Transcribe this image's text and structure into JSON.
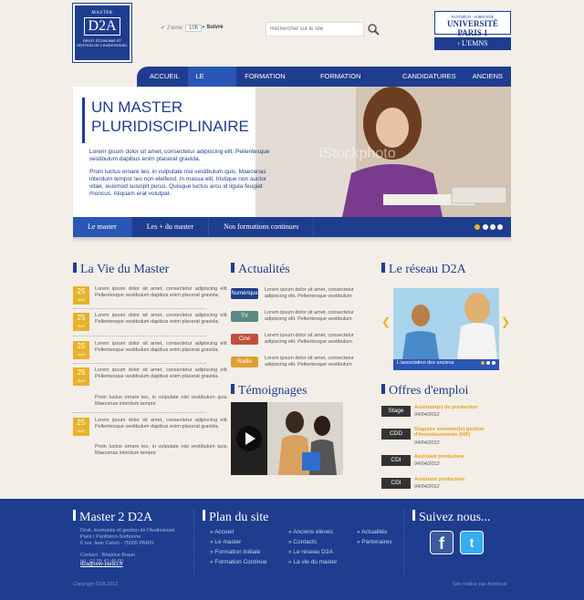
{
  "header": {
    "logo_line1": "MASTER",
    "logo_main": "D2A",
    "logo_line3": "DROIT, ÉCONOMIE ET GESTION DE L'AUDIOVISUEL",
    "like_label": "J'aime",
    "like_count": "106",
    "follow_label": "Suivre",
    "search_placeholder": "Rechercher sur le site",
    "uni_line1": "PANTHÉON - SORBONNE",
    "uni_line2": "UNIVERSITÉ PARIS 1",
    "emns_label": "L'EMNS"
  },
  "nav": [
    "ACCUEIL",
    "LE MASTER",
    "FORMATION INITIALE",
    "FORMATION CONTINUE",
    "CANDIDATURES",
    "ANCIENS"
  ],
  "hero": {
    "title": "UN MASTER PLURIDISCIPLINAIRE",
    "p1": "Lorem ipsum dolor sit amet, consectetur adipiscing elit. Pellentesque vestibulum dapibus enim placerat gravida.",
    "p2": "Proin luctus ornare leo, in vulputate nisi vestibulum quis. Maecenas interdum tempor leo non eleifend. In massa elit, tristique non auctor vitae, euismod suscipit purus. Quisque luctus arcu id ligula feugiat rhoncus. Aliquam erat volutpat.",
    "watermark": "iStockphoto",
    "tabs": [
      "Le master",
      "Les + du master",
      "Nos formations continues"
    ]
  },
  "vie": {
    "title": "La Vie du Master",
    "items": [
      {
        "day": "25",
        "month": "AVR",
        "text": "Lorem ipsum dolor sit amet, consectetur adipiscing elit. Pellentesque vestibulum dapibus enim placerat gravida."
      },
      {
        "day": "25",
        "month": "AVR",
        "text": "Lorem ipsum dolor sit amet, consectetur adipiscing elit. Pellentesque vestibulum dapibus enim placerat gravida."
      },
      {
        "day": "25",
        "month": "AVR",
        "text": "Lorem ipsum dolor sit amet, consectetur adipiscing elit. Pellentesque vestibulum dapibus enim placerat gravida."
      },
      {
        "day": "25",
        "month": "AVR",
        "text": "Lorem ipsum dolor sit amet, consectetur adipiscing elit. Pellentesque vestibulum dapibus enim placerat gravida."
      },
      {
        "day": "",
        "month": "",
        "text": "Proin luctus ornare leo, in vulputate nisi vestibulum quis. Maecenas interdum tempor"
      },
      {
        "day": "25",
        "month": "AVR",
        "text": "Lorem ipsum dolor sit amet, consectetur adipiscing elit. Pellentesque vestibulum dapibus enim placerat gravida."
      },
      {
        "day": "",
        "month": "",
        "text": "Proin luctus ornare leo, in vulputate nisi vestibulum quis. Maecenas interdum tempor"
      }
    ]
  },
  "actualites": {
    "title": "Actualités",
    "items": [
      {
        "tag": "Numérique",
        "color": "#1e3d8f",
        "text": "Lorem ipsum dolor sit amet, consectetur adipiscing elit. Pellentesque vestibulum"
      },
      {
        "tag": "TV",
        "color": "#5a8a82",
        "text": "Lorem ipsum dolor sit amet, consectetur adipiscing elit. Pellentesque vestibulum"
      },
      {
        "tag": "Ciné",
        "color": "#c0503a",
        "text": "Lorem ipsum dolor sit amet, consectetur adipiscing elit. Pellentesque vestibulum"
      },
      {
        "tag": "Radio",
        "color": "#e0a030",
        "text": "Lorem ipsum dolor sit amet, consectetur adipiscing elit. Pellentesque vestibulum"
      }
    ]
  },
  "temoignages": {
    "title": "Témoignages"
  },
  "reseau": {
    "title": "Le réseau D2A",
    "caption": "L'association des anciens"
  },
  "offres": {
    "title": "Offres d'emploi",
    "items": [
      {
        "type": "Stage",
        "title": "Assistant(e) de production",
        "date": "04/04/2012"
      },
      {
        "type": "CDD",
        "title": "Stagiaire assistant(e) gestion d'investissements (H/F)",
        "date": "04/04/2012"
      },
      {
        "type": "CDI",
        "title": "Assistant producteur",
        "date": "04/04/2012"
      },
      {
        "type": "CDI",
        "title": "Assistant producteur",
        "date": "04/04/2012"
      }
    ]
  },
  "footer": {
    "col1_title": "Master 2 D2A",
    "col1_line1": "Droit, économie et gestion de l'Audiovisuel",
    "col1_line2": "Paris I Panthéon-Sorbonne",
    "col1_line3": "6 rue Jean Calvin - 75005 PARIS",
    "contact": "Contact : Béatrice Braun",
    "tel": "tél : 01 55 43 46 60",
    "email": "d2a@univ-paris1.fr",
    "col2_title": "Plan du site",
    "links": [
      "Accueil",
      "Le master",
      "Formation Initiale",
      "Formation Continue",
      "Anciens élèves",
      "Contacts",
      "Le réseau D2A",
      "La vie du master",
      "Actualités",
      "Partenaires"
    ],
    "col3_title": "Suivez nous...",
    "copyright": "Copyright D2A 2012",
    "credit": "Site réalisé par Axebook"
  },
  "colors": {
    "primary": "#1e3d8f",
    "accent": "#e8b22a"
  }
}
